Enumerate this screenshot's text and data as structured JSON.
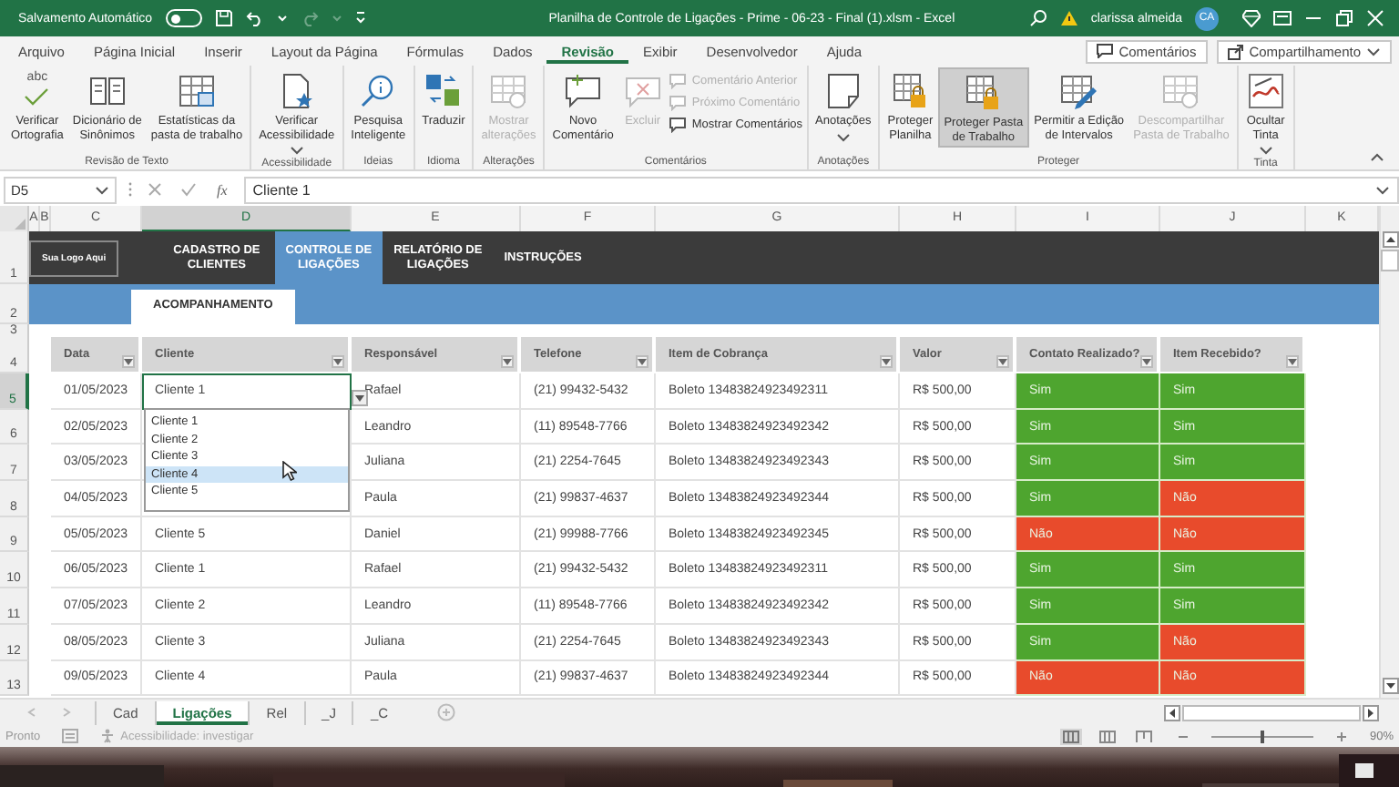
{
  "title_bar": {
    "autosave_label": "Salvamento Automático",
    "autosave_on": false,
    "title": "Planilha de Controle de Ligações - Prime - 06-23 - Final (1).xlsm  -  Excel",
    "user_name": "clarissa almeida",
    "user_initials": "CA"
  },
  "menu_tabs": [
    {
      "label": "Arquivo",
      "selected": false
    },
    {
      "label": "Página Inicial",
      "selected": false
    },
    {
      "label": "Inserir",
      "selected": false
    },
    {
      "label": "Layout da Página",
      "selected": false
    },
    {
      "label": "Fórmulas",
      "selected": false
    },
    {
      "label": "Dados",
      "selected": false
    },
    {
      "label": "Revisão",
      "selected": true
    },
    {
      "label": "Exibir",
      "selected": false
    },
    {
      "label": "Desenvolvedor",
      "selected": false
    },
    {
      "label": "Ajuda",
      "selected": false
    }
  ],
  "ribbon_actions": [
    "Comentários",
    "Compartilhamento"
  ],
  "ribbon_groups": [
    {
      "label": "Revisão de Texto",
      "items": [
        {
          "kind": "large",
          "label": "Verificar\nOrtografia",
          "glyph": "abc",
          "disabled": false
        },
        {
          "kind": "large",
          "label": "Dicionário de\nSinônimos",
          "disabled": false
        },
        {
          "kind": "large",
          "label": "Estatísticas da\npasta de trabalho",
          "disabled": false
        }
      ]
    },
    {
      "label": "Acessibilidade",
      "items": [
        {
          "kind": "large",
          "label": "Verificar\nAcessibilidade",
          "has_menu": true,
          "disabled": false
        }
      ]
    },
    {
      "label": "Ideias",
      "items": [
        {
          "kind": "large",
          "label": "Pesquisa\nInteligente",
          "disabled": false
        }
      ]
    },
    {
      "label": "Idioma",
      "items": [
        {
          "kind": "large",
          "label": "Traduzir",
          "disabled": false
        }
      ]
    },
    {
      "label": "Alterações",
      "items": [
        {
          "kind": "large",
          "label": "Mostrar\nalterações",
          "disabled": true
        }
      ]
    },
    {
      "label": "Comentários",
      "items": [
        {
          "kind": "large",
          "label": "Novo\nComentário",
          "disabled": false
        },
        {
          "kind": "large",
          "label": "Excluir",
          "disabled": true
        },
        {
          "kind": "small",
          "label": "Comentário Anterior",
          "disabled": true
        },
        {
          "kind": "small",
          "label": "Próximo Comentário",
          "disabled": true
        },
        {
          "kind": "small",
          "label": "Mostrar Comentários",
          "disabled": false
        }
      ]
    },
    {
      "label": "Anotações",
      "items": [
        {
          "kind": "large",
          "label": "Anotações",
          "has_menu": true,
          "disabled": false
        }
      ]
    },
    {
      "label": "Proteger",
      "items": [
        {
          "kind": "large",
          "label": "Proteger\nPlanilha",
          "disabled": false,
          "selected": false
        },
        {
          "kind": "large",
          "label": "Proteger Pasta\nde Trabalho",
          "disabled": false,
          "selected": true
        },
        {
          "kind": "large",
          "label": "Permitir a Edição\nde Intervalos",
          "disabled": false,
          "selected": false
        },
        {
          "kind": "large",
          "label": "Descompartilhar\nPasta de Trabalho",
          "disabled": true,
          "selected": false
        }
      ]
    },
    {
      "label": "Tinta",
      "items": [
        {
          "kind": "large",
          "label": "Ocultar\nTinta",
          "has_menu": true,
          "disabled": false
        }
      ]
    }
  ],
  "name_box": "D5",
  "function_label": "fx",
  "formula": "Cliente 1",
  "column_headers": [
    {
      "label": "A",
      "selected": false
    },
    {
      "label": "B",
      "selected": false
    },
    {
      "label": "C",
      "selected": false
    },
    {
      "label": "D",
      "selected": true
    },
    {
      "label": "E",
      "selected": false
    },
    {
      "label": "F",
      "selected": false
    },
    {
      "label": "G",
      "selected": false
    },
    {
      "label": "H",
      "selected": false
    },
    {
      "label": "I",
      "selected": false
    },
    {
      "label": "J",
      "selected": false
    },
    {
      "label": "K",
      "selected": false
    }
  ],
  "row_numbers": [
    {
      "label": "1",
      "selected": false
    },
    {
      "label": "2",
      "selected": false
    },
    {
      "label": "3",
      "selected": false
    },
    {
      "label": "4",
      "selected": false
    },
    {
      "label": "5",
      "selected": true
    },
    {
      "label": "6",
      "selected": false
    },
    {
      "label": "7",
      "selected": false
    },
    {
      "label": "8",
      "selected": false
    },
    {
      "label": "9",
      "selected": false
    },
    {
      "label": "10",
      "selected": false
    },
    {
      "label": "11",
      "selected": false
    },
    {
      "label": "12",
      "selected": false
    },
    {
      "label": "13",
      "selected": false
    }
  ],
  "nav": {
    "logo": "Sua Logo Aqui",
    "items": [
      {
        "label": "CADASTRO DE\nCLIENTES",
        "selected": false
      },
      {
        "label": "CONTROLE DE\nLIGAÇÕES",
        "selected": true
      },
      {
        "label": "RELATÓRIO DE\nLIGAÇÕES",
        "selected": false
      },
      {
        "label": "INSTRUÇÕES",
        "selected": false
      }
    ]
  },
  "section_tab": "ACOMPANHAMENTO",
  "table": {
    "columns": [
      "Data",
      "Cliente",
      "Responsável",
      "Telefone",
      "Item de Cobrança",
      "Valor",
      "Contato Realizado?",
      "Item Recebido?"
    ],
    "rows": [
      {
        "active": true,
        "date": "01/05/2023",
        "client": "Cliente 1",
        "responsible": "Rafael",
        "phone": "(21) 99432-5432",
        "item": "Boleto 13483824923492311",
        "value": "R$ 500,00",
        "contact": {
          "text": "Sim",
          "positive": true
        },
        "received": {
          "text": "Sim",
          "positive": true
        }
      },
      {
        "active": false,
        "date": "02/05/2023",
        "responsible": "Leandro",
        "phone": "(11) 89548-7766",
        "item": "Boleto 13483824923492342",
        "value": "R$ 500,00",
        "contact": {
          "text": "Sim",
          "positive": true
        },
        "received": {
          "text": "Sim",
          "positive": true
        }
      },
      {
        "active": false,
        "date": "03/05/2023",
        "responsible": "Juliana",
        "phone": "(21) 2254-7645",
        "item": "Boleto 13483824923492343",
        "value": "R$ 500,00",
        "contact": {
          "text": "Sim",
          "positive": true
        },
        "received": {
          "text": "Sim",
          "positive": true
        }
      },
      {
        "active": false,
        "date": "04/05/2023",
        "responsible": "Paula",
        "phone": "(21) 99837-4637",
        "item": "Boleto 13483824923492344",
        "value": "R$ 500,00",
        "contact": {
          "text": "Sim",
          "positive": true
        },
        "received": {
          "text": "Não",
          "positive": false
        }
      },
      {
        "active": false,
        "date": "05/05/2023",
        "client": "Cliente 5",
        "responsible": "Daniel",
        "phone": "(21) 99988-7766",
        "item": "Boleto 13483824923492345",
        "value": "R$ 500,00",
        "contact": {
          "text": "Não",
          "positive": false
        },
        "received": {
          "text": "Não",
          "positive": false
        }
      },
      {
        "active": false,
        "date": "06/05/2023",
        "client": "Cliente 1",
        "responsible": "Rafael",
        "phone": "(21) 99432-5432",
        "item": "Boleto 13483824923492311",
        "value": "R$ 500,00",
        "contact": {
          "text": "Sim",
          "positive": true
        },
        "received": {
          "text": "Sim",
          "positive": true
        }
      },
      {
        "active": false,
        "date": "07/05/2023",
        "client": "Cliente 2",
        "responsible": "Leandro",
        "phone": "(11) 89548-7766",
        "item": "Boleto 13483824923492342",
        "value": "R$ 500,00",
        "contact": {
          "text": "Sim",
          "positive": true
        },
        "received": {
          "text": "Sim",
          "positive": true
        }
      },
      {
        "active": false,
        "date": "08/05/2023",
        "client": "Cliente 3",
        "responsible": "Juliana",
        "phone": "(21) 2254-7645",
        "item": "Boleto 13483824923492343",
        "value": "R$ 500,00",
        "contact": {
          "text": "Sim",
          "positive": true
        },
        "received": {
          "text": "Não",
          "positive": false
        }
      },
      {
        "active": false,
        "date": "09/05/2023",
        "client": "Cliente 4",
        "responsible": "Paula",
        "phone": "(21) 99837-4637",
        "item": "Boleto 13483824923492344",
        "value": "R$ 500,00",
        "contact": {
          "text": "Não",
          "positive": false
        },
        "received": {
          "text": "Não",
          "positive": false
        }
      }
    ]
  },
  "dropdown": {
    "items": [
      {
        "label": "Cliente 1",
        "selected": false
      },
      {
        "label": "Cliente 2",
        "selected": false
      },
      {
        "label": "Cliente 3",
        "selected": false
      },
      {
        "label": "Cliente 4",
        "selected": true
      },
      {
        "label": "Cliente 5",
        "selected": false
      }
    ]
  },
  "sheet_tabs": [
    {
      "label": "Cad",
      "selected": false
    },
    {
      "label": "Ligações",
      "selected": true
    },
    {
      "label": "Rel",
      "selected": false
    },
    {
      "label": "_J",
      "selected": false
    },
    {
      "label": "_C",
      "selected": false
    }
  ],
  "status_bar": {
    "ready": "Pronto",
    "accessibility": "Acessibilidade: investigar",
    "zoom": "90%",
    "zoom_slider": {
      "level": 0.5
    }
  }
}
